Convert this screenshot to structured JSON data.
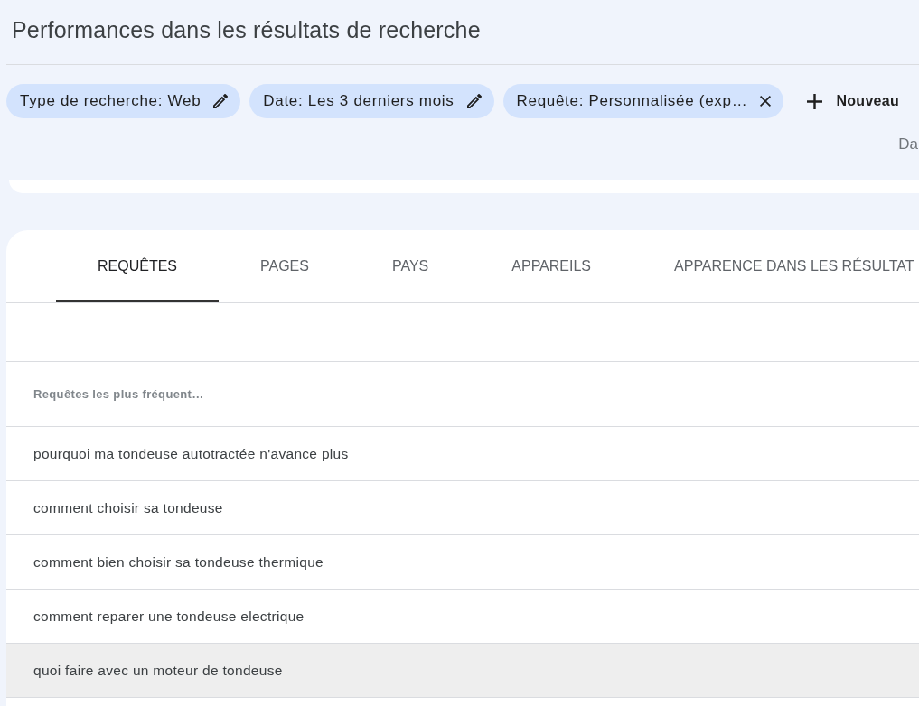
{
  "page": {
    "title": "Performances dans les résultats de recherche"
  },
  "filters": [
    {
      "label": "Type de recherche: Web",
      "kind": "edit"
    },
    {
      "label": "Date: Les 3 derniers mois",
      "kind": "edit"
    },
    {
      "label": "Requête: Personnalisée (exp…",
      "kind": "remove"
    }
  ],
  "new_filter_button": {
    "label": "Nouveau"
  },
  "truncated_label": "Da",
  "tabs": [
    {
      "label": "REQUÊTES",
      "selected": true
    },
    {
      "label": "PAGES",
      "selected": false
    },
    {
      "label": "PAYS",
      "selected": false
    },
    {
      "label": "APPAREILS",
      "selected": false
    },
    {
      "label": "APPARENCE DANS LES RÉSULTAT",
      "selected": false
    }
  ],
  "table": {
    "columns": [
      "Requêtes les plus fréquent…"
    ],
    "rows": [
      {
        "cells": [
          "pourquoi ma tondeuse autotractée n'avance plus"
        ],
        "highlighted": false
      },
      {
        "cells": [
          "comment choisir sa tondeuse"
        ],
        "highlighted": false
      },
      {
        "cells": [
          "comment bien choisir sa tondeuse thermique"
        ],
        "highlighted": false
      },
      {
        "cells": [
          "comment reparer une tondeuse electrique"
        ],
        "highlighted": false
      },
      {
        "cells": [
          "quoi faire avec un moteur de tondeuse"
        ],
        "highlighted": true
      }
    ]
  }
}
